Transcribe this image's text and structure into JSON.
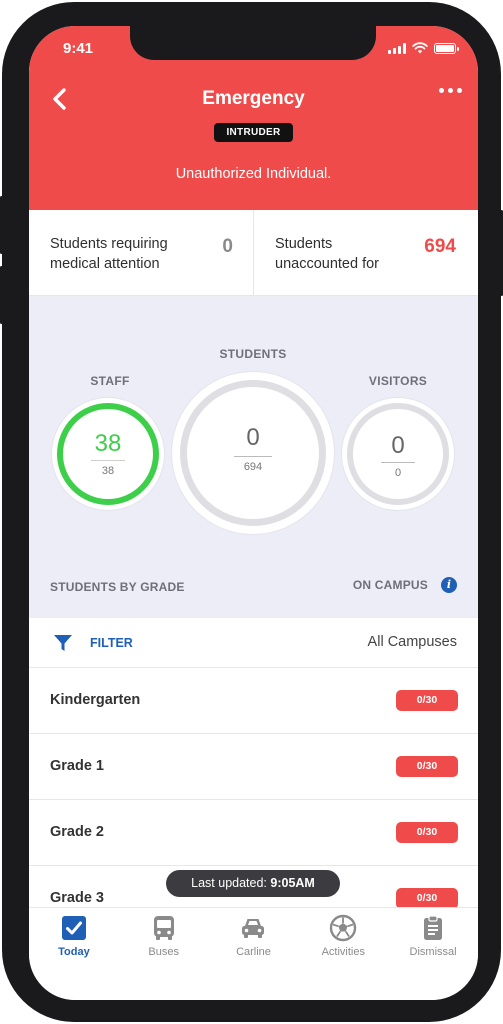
{
  "status_bar": {
    "time": "9:41"
  },
  "header": {
    "title": "Emergency",
    "badge": "INTRUDER",
    "subtitle": "Unauthorized Individual."
  },
  "stats": [
    {
      "label": "Students requiring medical attention",
      "value": "0"
    },
    {
      "label": "Students unaccounted for",
      "value": "694"
    }
  ],
  "summary": {
    "staff": {
      "label": "STAFF",
      "count": "38",
      "total": "38"
    },
    "students": {
      "label": "STUDENTS",
      "count": "0",
      "total": "694"
    },
    "visitors": {
      "label": "VISITORS",
      "count": "0",
      "total": "0"
    },
    "section_title": "STUDENTS BY GRADE",
    "on_campus_label": "ON CAMPUS"
  },
  "filter": {
    "label": "FILTER",
    "campus": "All Campuses"
  },
  "grades": [
    {
      "name": "Kindergarten",
      "count": "0/30"
    },
    {
      "name": "Grade 1",
      "count": "0/30"
    },
    {
      "name": "Grade 2",
      "count": "0/30"
    },
    {
      "name": "Grade 3",
      "count": "0/30"
    }
  ],
  "toast": {
    "prefix": "Last updated:",
    "time": "9:05AM"
  },
  "tabs": [
    {
      "label": "Today",
      "icon": "checkbox-icon",
      "active": true
    },
    {
      "label": "Buses",
      "icon": "bus-icon",
      "active": false
    },
    {
      "label": "Carline",
      "icon": "car-icon",
      "active": false
    },
    {
      "label": "Activities",
      "icon": "soccer-ball-icon",
      "active": false
    },
    {
      "label": "Dismissal",
      "icon": "clipboard-icon",
      "active": false
    }
  ],
  "colors": {
    "emergency_red": "#f04b4b",
    "accent_blue": "#1f5fb5",
    "staff_green": "#3ecf4a",
    "panel_bg": "#ecedf6"
  }
}
